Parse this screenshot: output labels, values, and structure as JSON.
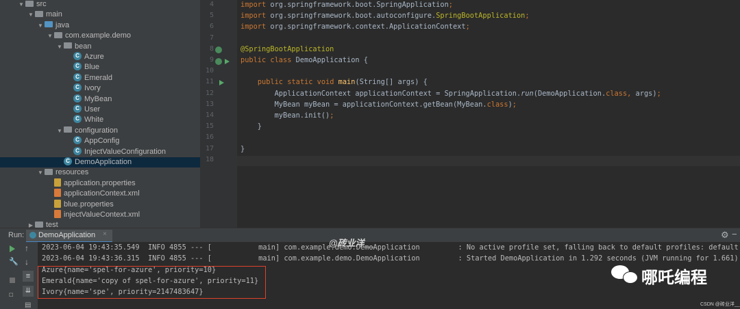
{
  "tree": {
    "items": [
      {
        "label": "src",
        "depth": 1,
        "icon": "folder",
        "chev": "v"
      },
      {
        "label": "main",
        "depth": 2,
        "icon": "folder",
        "chev": "v"
      },
      {
        "label": "java",
        "depth": 3,
        "icon": "folder-blue",
        "chev": "v"
      },
      {
        "label": "com.example.demo",
        "depth": 4,
        "icon": "package",
        "chev": "v"
      },
      {
        "label": "bean",
        "depth": 5,
        "icon": "package",
        "chev": "v"
      },
      {
        "label": "Azure",
        "depth": 6,
        "icon": "class"
      },
      {
        "label": "Blue",
        "depth": 6,
        "icon": "class"
      },
      {
        "label": "Emerald",
        "depth": 6,
        "icon": "class"
      },
      {
        "label": "Ivory",
        "depth": 6,
        "icon": "class"
      },
      {
        "label": "MyBean",
        "depth": 6,
        "icon": "class"
      },
      {
        "label": "User",
        "depth": 6,
        "icon": "class"
      },
      {
        "label": "White",
        "depth": 6,
        "icon": "class"
      },
      {
        "label": "configuration",
        "depth": 5,
        "icon": "package",
        "chev": "v"
      },
      {
        "label": "AppConfig",
        "depth": 6,
        "icon": "class"
      },
      {
        "label": "InjectValueConfiguration",
        "depth": 6,
        "icon": "class"
      },
      {
        "label": "DemoApplication",
        "depth": 5,
        "icon": "class",
        "selected": true
      },
      {
        "label": "resources",
        "depth": 3,
        "icon": "folder",
        "chev": "v"
      },
      {
        "label": "application.properties",
        "depth": 4,
        "icon": "properties"
      },
      {
        "label": "applicationContext.xml",
        "depth": 4,
        "icon": "xml"
      },
      {
        "label": "blue.properties",
        "depth": 4,
        "icon": "properties"
      },
      {
        "label": "injectValueContext.xml",
        "depth": 4,
        "icon": "xml"
      },
      {
        "label": "test",
        "depth": 2,
        "icon": "folder",
        "chev": ">"
      }
    ],
    "class_badge": "C"
  },
  "editor": {
    "line_numbers": [
      "4",
      "5",
      "6",
      "7",
      "8",
      "9",
      "10",
      "11",
      "12",
      "13",
      "14",
      "15",
      "16",
      "17",
      "18"
    ],
    "lines": [
      {
        "n": "4",
        "text": "import org.springframework.boot.SpringApplication;"
      },
      {
        "n": "5",
        "text": "import org.springframework.boot.autoconfigure.SpringBootApplication;"
      },
      {
        "n": "6",
        "text": "import org.springframework.context.ApplicationContext;"
      },
      {
        "n": "7",
        "text": ""
      },
      {
        "n": "8",
        "text": "@SpringBootApplication"
      },
      {
        "n": "9",
        "text": "public class DemoApplication {"
      },
      {
        "n": "10",
        "text": ""
      },
      {
        "n": "11",
        "text": "    public static void main(String[] args) {"
      },
      {
        "n": "12",
        "text": "        ApplicationContext applicationContext = SpringApplication.run(DemoApplication.class, args);"
      },
      {
        "n": "13",
        "text": "        MyBean myBean = applicationContext.getBean(MyBean.class);"
      },
      {
        "n": "14",
        "text": "        myBean.init();"
      },
      {
        "n": "15",
        "text": "    }"
      },
      {
        "n": "16",
        "text": ""
      },
      {
        "n": "17",
        "text": "}"
      },
      {
        "n": "18",
        "text": ""
      }
    ]
  },
  "run": {
    "label": "Run:",
    "tab": "DemoApplication",
    "logs": [
      "2023-06-04 19:43:35.549  INFO 4855 --- [           main] com.example.demo.DemoApplication         : No active profile set, falling back to default profiles: default",
      "2023-06-04 19:43:36.315  INFO 4855 --- [           main] com.example.demo.DemoApplication         : Started DemoApplication in 1.292 seconds (JVM running for 1.661)",
      "Azure{name='spel-for-azure', priority=10}",
      "Emerald{name='copy of spel-for-azure', priority=11}",
      "Ivory{name='spe', priority=2147483647}"
    ]
  },
  "watermarks": {
    "author": "@砖业洋__",
    "brand": "哪吒编程",
    "csdn": "CSDN @砖业洋__"
  },
  "colors": {
    "highlight_box": "#e0412d",
    "keyword": "#cc7832",
    "annotation": "#bbb529",
    "method": "#ffc66d"
  }
}
